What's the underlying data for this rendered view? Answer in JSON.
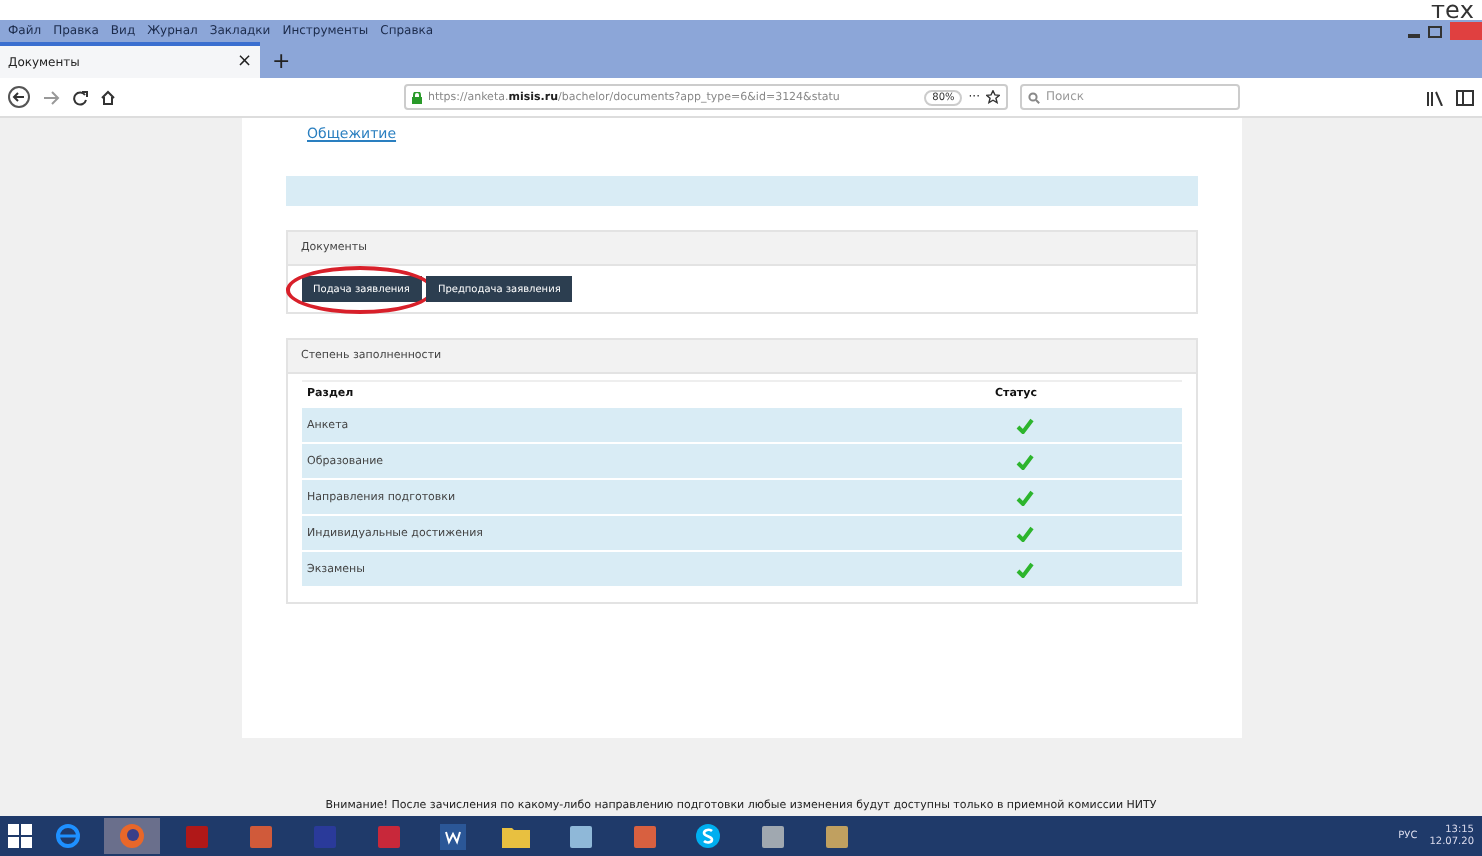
{
  "overlay_text": "тех",
  "menu": [
    "Файл",
    "Правка",
    "Вид",
    "Журнал",
    "Закладки",
    "Инструменты",
    "Справка"
  ],
  "tab": {
    "title": "Документы",
    "close": "×",
    "new": "+"
  },
  "address": {
    "host": "https://anketa.",
    "domain": "misis.ru",
    "path": "/bachelor/documents?app_type=6&id=3124&statu",
    "zoom": "80%",
    "more": "···"
  },
  "search": {
    "placeholder": "Поиск"
  },
  "link": "Общежитие",
  "documents": {
    "title": "Документы",
    "buttons": [
      {
        "label": "Подача заявления",
        "circled": true
      },
      {
        "label": "Предподача заявления",
        "circled": false
      }
    ]
  },
  "progress": {
    "title": "Степень заполненности",
    "columns": [
      "Раздел",
      "Статус"
    ],
    "rows": [
      {
        "section": "Анкета",
        "done": true
      },
      {
        "section": "Образование",
        "done": true
      },
      {
        "section": "Направления подготовки",
        "done": true
      },
      {
        "section": "Индивидуальные достижения",
        "done": true
      },
      {
        "section": "Экзамены",
        "done": true
      }
    ]
  },
  "notice": "Внимание! После зачисления по какому-либо направлению подготовки любые изменения будут доступны только в приемной комиссии НИТУ",
  "taskbar": {
    "apps": [
      {
        "kind": "ie",
        "selected": false
      },
      {
        "kind": "firefox",
        "selected": true
      },
      {
        "kind": "pdf",
        "selected": false
      },
      {
        "kind": "doc",
        "selected": false
      },
      {
        "kind": "save",
        "selected": false
      },
      {
        "kind": "book",
        "selected": false
      },
      {
        "kind": "word",
        "selected": false
      },
      {
        "kind": "folder",
        "selected": false
      },
      {
        "kind": "calc",
        "selected": false
      },
      {
        "kind": "media",
        "selected": false
      },
      {
        "kind": "skype",
        "selected": false
      },
      {
        "kind": "scan",
        "selected": false
      },
      {
        "kind": "paint",
        "selected": false
      }
    ],
    "lang": "РУС",
    "time": "13:15",
    "date": "12.07.20"
  }
}
